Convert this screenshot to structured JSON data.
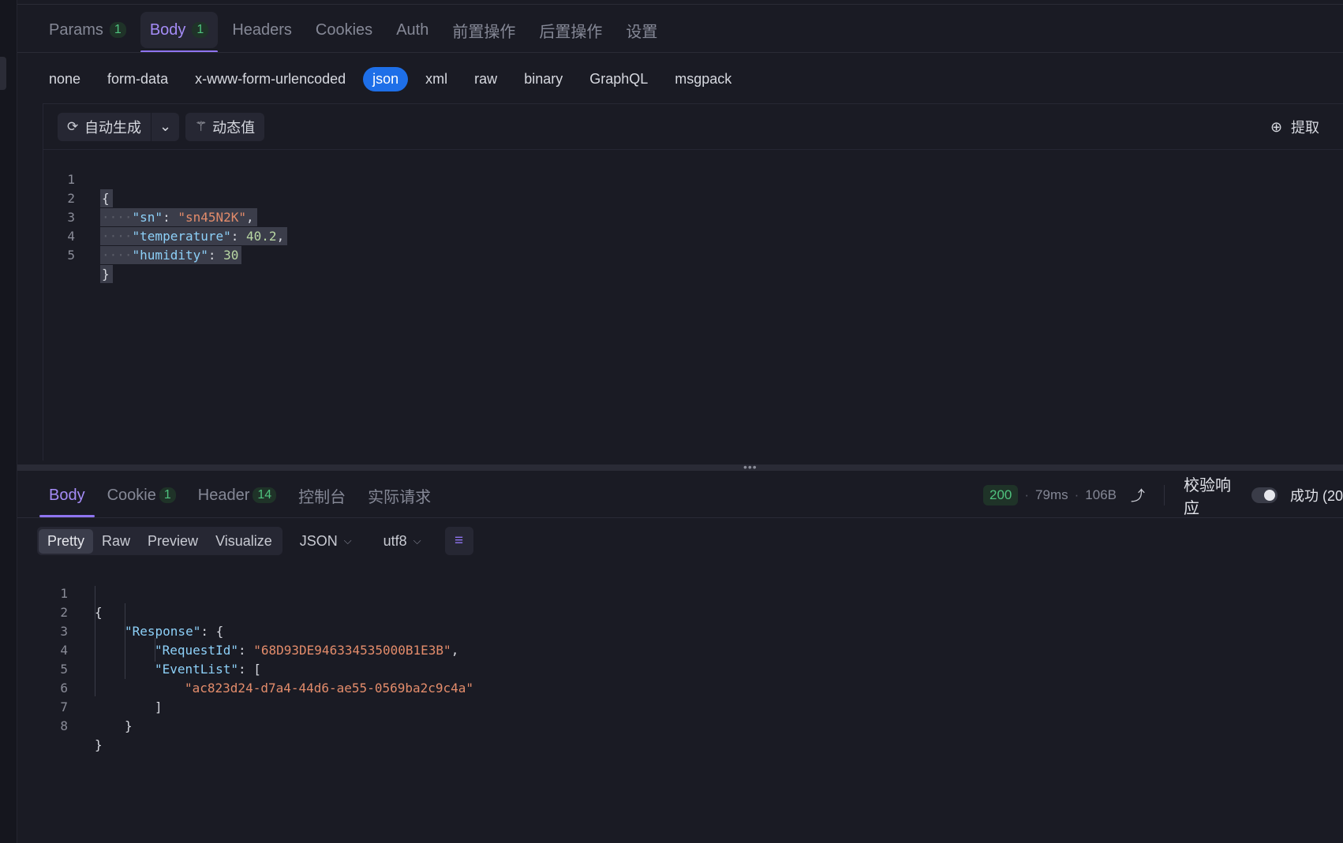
{
  "request_tabs": [
    {
      "label": "Params",
      "badge": "1"
    },
    {
      "label": "Body",
      "badge": "1"
    },
    {
      "label": "Headers"
    },
    {
      "label": "Cookies"
    },
    {
      "label": "Auth"
    },
    {
      "label": "前置操作"
    },
    {
      "label": "后置操作"
    },
    {
      "label": "设置"
    }
  ],
  "active_request_tab": "Body",
  "body_types": [
    "none",
    "form-data",
    "x-www-form-urlencoded",
    "json",
    "xml",
    "raw",
    "binary",
    "GraphQL",
    "msgpack"
  ],
  "active_body_type": "json",
  "editor_toolbar": {
    "auto_generate": "自动生成",
    "dynamic_value": "动态值",
    "extract": "提取",
    "icons": {
      "auto": "refresh-icon",
      "dropdown": "chevron-down-icon",
      "dynamic": "magic-wand-icon",
      "extract": "upload-circle-icon"
    }
  },
  "request_body": {
    "line_numbers": [
      "1",
      "2",
      "3",
      "4",
      "5"
    ],
    "open_brace": "{",
    "close_brace": "}",
    "fields": [
      {
        "key": "\"sn\"",
        "value": "\"sn45N2K\"",
        "trail": ","
      },
      {
        "key": "\"temperature\"",
        "value": "40.2",
        "trail": ","
      },
      {
        "key": "\"humidity\"",
        "value": "30",
        "trail": ""
      }
    ]
  },
  "response_tabs": [
    {
      "label": "Body"
    },
    {
      "label": "Cookie",
      "badge": "1"
    },
    {
      "label": "Header",
      "badge": "14"
    },
    {
      "label": "控制台"
    },
    {
      "label": "实际请求"
    }
  ],
  "active_response_tab": "Body",
  "response_status": {
    "code": "200",
    "time": "79ms",
    "size": "106B",
    "verify_label": "校验响应",
    "verify_enabled": true,
    "result": "成功 (20"
  },
  "response_view": {
    "modes": [
      "Pretty",
      "Raw",
      "Preview",
      "Visualize"
    ],
    "active_mode": "Pretty",
    "format": "JSON",
    "encoding": "utf8"
  },
  "response_body": {
    "line_numbers": [
      "1",
      "2",
      "3",
      "4",
      "5",
      "6",
      "7",
      "8"
    ],
    "lines": [
      [
        "{"
      ],
      [
        "\"Response\"",
        ": {"
      ],
      [
        "\"RequestId\"",
        ": ",
        "\"68D93DE946334535000B1E3B\"",
        ","
      ],
      [
        "\"EventList\"",
        ": ["
      ],
      [
        "\"ac823d24-d7a4-44d6-ae55-0569ba2c9c4a\""
      ],
      [
        "]"
      ],
      [
        "}"
      ],
      [
        "}"
      ]
    ]
  },
  "colors": {
    "accent": "#8f74f0",
    "json_active": "#1e6fe8",
    "success": "#4fc27e",
    "key": "#8dd0f8",
    "string": "#e38c6b",
    "number": "#b8d7a3"
  }
}
